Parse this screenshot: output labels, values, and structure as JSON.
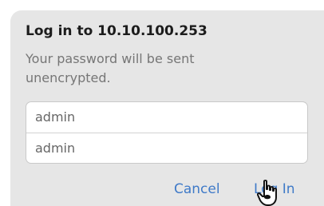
{
  "dialog": {
    "title": "Log in to 10.10.100.253",
    "message": "Your password will be sent unencrypted.",
    "username_value": "admin",
    "password_value": "admin",
    "cancel_label": "Cancel",
    "login_label": "Log In"
  },
  "colors": {
    "accent": "#3f7ac8",
    "dialog_background": "#e6e6e6"
  },
  "cursor_icon": "hand-pointer-icon"
}
